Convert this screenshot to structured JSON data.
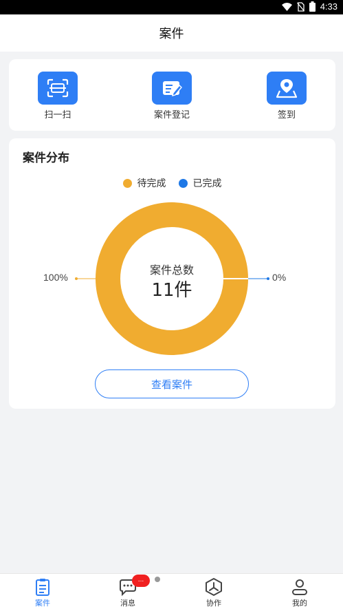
{
  "status_bar": {
    "time": "4:33",
    "icons": [
      "wifi-icon",
      "no-sim-icon",
      "battery-icon"
    ]
  },
  "header": {
    "title": "案件"
  },
  "quick_actions": [
    {
      "label": "扫一扫",
      "icon": "scan-icon"
    },
    {
      "label": "案件登记",
      "icon": "case-register-icon"
    },
    {
      "label": "签到",
      "icon": "location-checkin-icon"
    }
  ],
  "distribution": {
    "title": "案件分布",
    "legend": [
      {
        "label": "待完成",
        "color": "#f0ac30"
      },
      {
        "label": "已完成",
        "color": "#1e78e6"
      }
    ],
    "center_label": "案件总数",
    "center_value": "11件",
    "pending_pct": "100%",
    "done_pct": "0%",
    "view_button": "查看案件"
  },
  "chart_data": {
    "type": "pie",
    "categories": [
      "待完成",
      "已完成"
    ],
    "values": [
      100,
      0
    ],
    "unit": "%",
    "colors": [
      "#f0ac30",
      "#1e78e6"
    ],
    "center_text": [
      "案件总数",
      "11件"
    ],
    "legend": "top"
  },
  "tabbar": {
    "tabs": [
      {
        "label": "案件",
        "icon": "clipboard-icon",
        "active": true
      },
      {
        "label": "消息",
        "icon": "chat-icon",
        "active": false
      },
      {
        "label": "协作",
        "icon": "collaboration-icon",
        "active": false
      },
      {
        "label": "我的",
        "icon": "profile-icon",
        "active": false
      }
    ],
    "message_badge": "..."
  },
  "colors": {
    "accent": "#2e7ef5",
    "pending": "#f0ac30",
    "done": "#1e78e6",
    "badge": "#f02020"
  }
}
